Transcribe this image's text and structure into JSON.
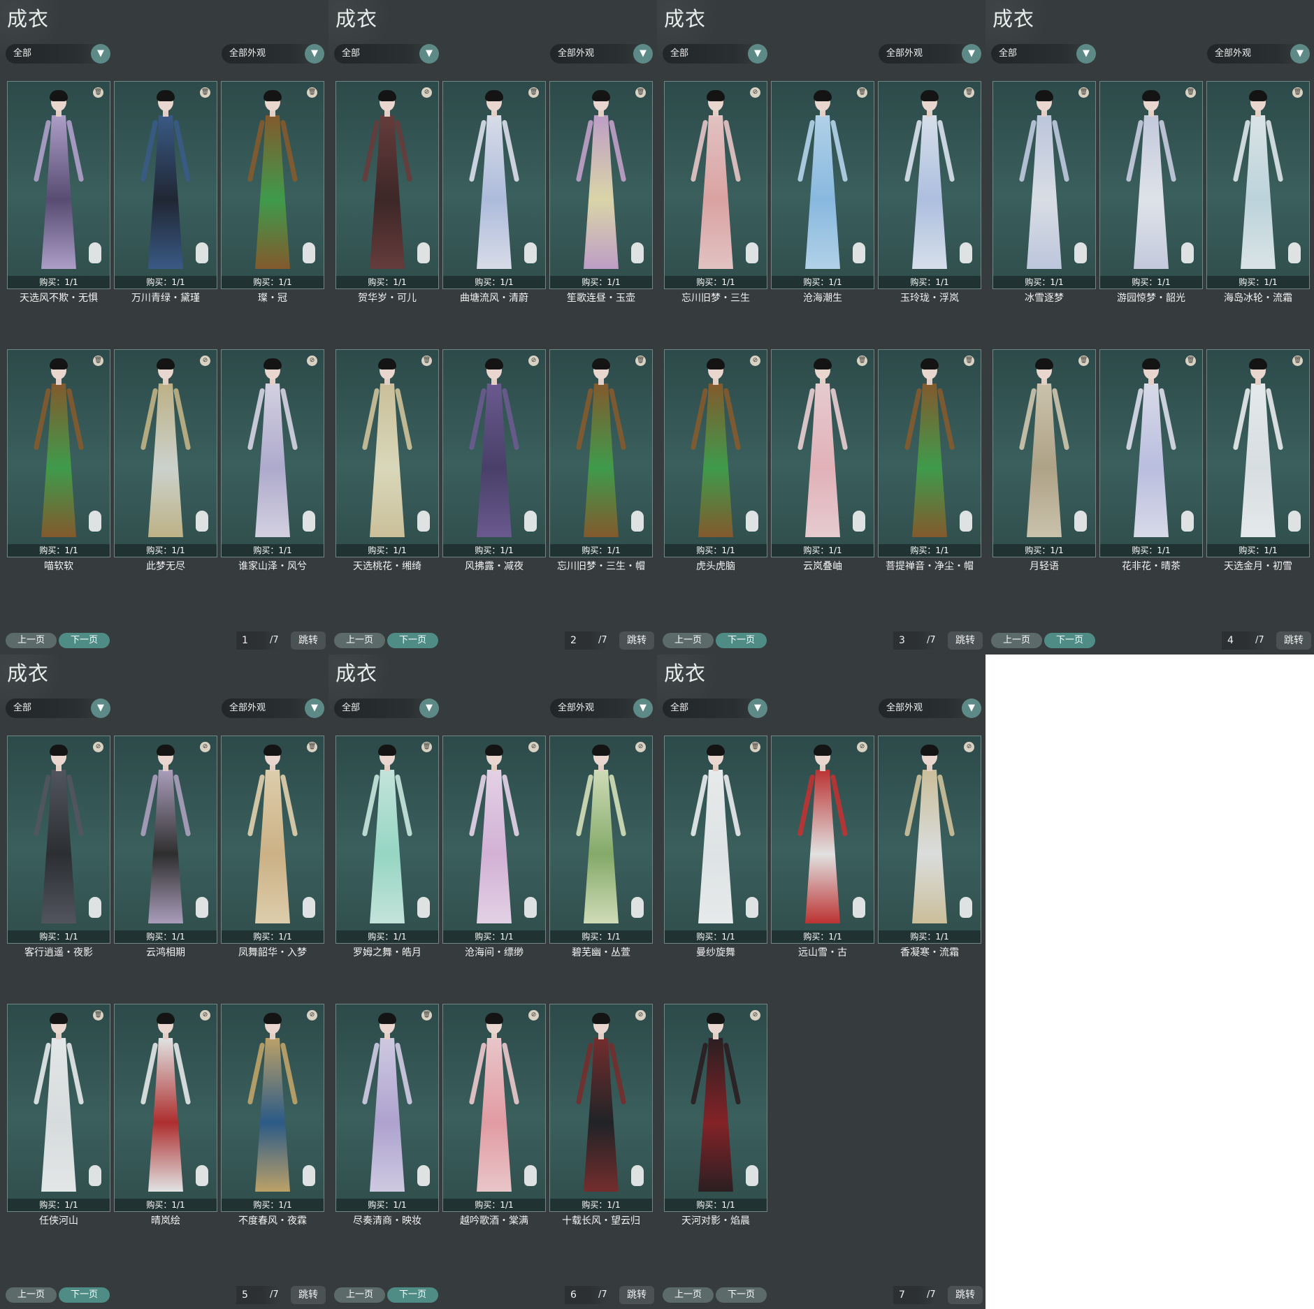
{
  "ui": {
    "title": "成衣",
    "filter_category": "全部",
    "filter_appearance": "全部外观",
    "prev_label": "上一页",
    "next_label": "下一页",
    "jump_label": "跳转",
    "total_pages_label": "/7",
    "buy_label": "购买：1/1",
    "dropdown_icon": "chevron-down-icon"
  },
  "pages": [
    {
      "page": "1",
      "items": [
        {
          "name": "天选风不欺・无惧",
          "badge": "trash",
          "colors": [
            "#5a4a74",
            "#b7a5d1"
          ]
        },
        {
          "name": "万川青绿・黛瑾",
          "badge": "trash",
          "colors": [
            "#1e2230",
            "#3a5a8a"
          ]
        },
        {
          "name": "璨・冠",
          "badge": "trash",
          "colors": [
            "#3fa04a",
            "#8a5a2a"
          ]
        },
        {
          "name": "喵软软",
          "badge": "trash",
          "colors": [
            "#3fa04a",
            "#8a5a2a"
          ]
        },
        {
          "name": "此梦无尽",
          "badge": "forbidden",
          "colors": [
            "#d8dcd6",
            "#c9b98a"
          ]
        },
        {
          "name": "谁家山泽・风兮",
          "badge": "forbidden",
          "colors": [
            "#b8b0d6",
            "#e1dced"
          ]
        }
      ]
    },
    {
      "page": "2",
      "items": [
        {
          "name": "贺华岁・可儿",
          "badge": "forbidden",
          "colors": [
            "#3d2222",
            "#6a3a3a"
          ]
        },
        {
          "name": "曲塘流风・清蔚",
          "badge": "trash",
          "colors": [
            "#b7c3e6",
            "#e6e8f5"
          ]
        },
        {
          "name": "笙歌连昼・玉壶",
          "badge": "trash",
          "colors": [
            "#e8dfae",
            "#c9a4d0"
          ]
        },
        {
          "name": "天选桃花・缃绮",
          "badge": "trash",
          "colors": [
            "#e6e2c2",
            "#d8c9a0"
          ]
        },
        {
          "name": "风拂露・减夜",
          "badge": "forbidden",
          "colors": [
            "#4a3d6a",
            "#6f5a94"
          ]
        },
        {
          "name": "忘川旧梦・三生・帽",
          "badge": "trash",
          "colors": [
            "#3fa04a",
            "#8a5a2a"
          ]
        }
      ]
    },
    {
      "page": "3",
      "items": [
        {
          "name": "忘川旧梦・三生",
          "badge": "forbidden",
          "colors": [
            "#e8a8a8",
            "#f1cccc"
          ]
        },
        {
          "name": "沧海潮生",
          "badge": "trash",
          "colors": [
            "#8fc0ea",
            "#bcdcf5"
          ]
        },
        {
          "name": "玉玲珑・浮岚",
          "badge": "trash",
          "colors": [
            "#b7c7ea",
            "#e4ebf7"
          ]
        },
        {
          "name": "虎头虎脑",
          "badge": "forbidden",
          "colors": [
            "#3fa04a",
            "#8a5a2a"
          ]
        },
        {
          "name": "云岚叠岫",
          "badge": "trash",
          "colors": [
            "#f0b8c0",
            "#f5d6da"
          ]
        },
        {
          "name": "菩提禅音・净尘・帽",
          "badge": "trash",
          "colors": [
            "#3fa04a",
            "#8a5a2a"
          ]
        }
      ]
    },
    {
      "page": "4",
      "items": [
        {
          "name": "冰雪逐梦",
          "badge": "trash",
          "colors": [
            "#e6e8f0",
            "#c8d0e8"
          ]
        },
        {
          "name": "游园惊梦・韶光",
          "badge": "trash",
          "colors": [
            "#eceef5",
            "#d0d4e8"
          ]
        },
        {
          "name": "海岛冰轮・流霜",
          "badge": "trash",
          "colors": [
            "#c7dde6",
            "#e8f0f3"
          ]
        },
        {
          "name": "月轻语",
          "badge": "trash",
          "colors": [
            "#b8a88a",
            "#d8ccb4"
          ]
        },
        {
          "name": "花非花・晴茶",
          "badge": "trash",
          "colors": [
            "#c5c6ea",
            "#e6e6f5"
          ]
        },
        {
          "name": "天选金月・初雪",
          "badge": "trash",
          "colors": [
            "#e4e8ec",
            "#f4f6f8"
          ]
        }
      ]
    },
    {
      "page": "5",
      "items": [
        {
          "name": "客行逍遥・夜影",
          "badge": "forbidden",
          "colors": [
            "#2a2a2e",
            "#555560"
          ]
        },
        {
          "name": "云鸿相期",
          "badge": "forbidden",
          "colors": [
            "#2e2a2a",
            "#b4a4c4"
          ]
        },
        {
          "name": "凤舞韶华・入梦",
          "badge": "trash",
          "colors": [
            "#d8b888",
            "#ecd8b4"
          ]
        },
        {
          "name": "任侠河山",
          "badge": "trash",
          "colors": [
            "#e4e6e8",
            "#f2f3f4"
          ]
        },
        {
          "name": "晴岚绘",
          "badge": "forbidden",
          "colors": [
            "#b82a2a",
            "#f0f0f0"
          ]
        },
        {
          "name": "不度春风・夜霖",
          "badge": "forbidden",
          "colors": [
            "#2a5a8a",
            "#c8a86a"
          ]
        }
      ]
    },
    {
      "page": "6",
      "items": [
        {
          "name": "罗姆之舞・皓月",
          "badge": "trash",
          "colors": [
            "#9ee0cc",
            "#d0f0e6"
          ]
        },
        {
          "name": "沧海间・缥缈",
          "badge": "forbidden",
          "colors": [
            "#e0b8e0",
            "#f2dcf2"
          ]
        },
        {
          "name": "碧芜幽・丛萱",
          "badge": "forbidden",
          "colors": [
            "#8ab06a",
            "#dde8c0"
          ]
        },
        {
          "name": "尽奏清商・映妆",
          "badge": "trash",
          "colors": [
            "#b8a8d8",
            "#dcd4ee"
          ]
        },
        {
          "name": "越吟歌酒・棠满",
          "badge": "forbidden",
          "colors": [
            "#f0a0a8",
            "#f8d0d4"
          ]
        },
        {
          "name": "十载长风・望云归",
          "badge": "forbidden",
          "colors": [
            "#1e1e22",
            "#7a2a2a"
          ]
        }
      ]
    },
    {
      "page": "7",
      "items": [
        {
          "name": "曼纱旋舞",
          "badge": "trash",
          "colors": [
            "#eceef0",
            "#f6f7f8"
          ]
        },
        {
          "name": "远山雪・古",
          "badge": "forbidden",
          "colors": [
            "#f0ecec",
            "#c83030"
          ]
        },
        {
          "name": "香凝寒・流霜",
          "badge": "forbidden",
          "colors": [
            "#e8e8e8",
            "#d8c8a0"
          ]
        },
        {
          "name": "天河对影・焰晨",
          "badge": "forbidden",
          "colors": [
            "#8a1e22",
            "#2a1a1e"
          ]
        }
      ]
    }
  ]
}
